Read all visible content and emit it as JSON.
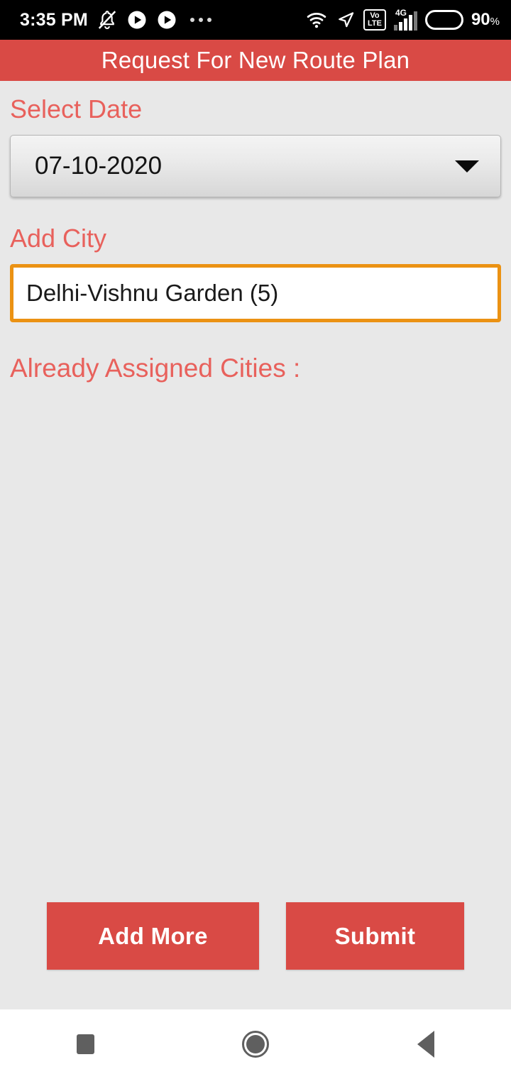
{
  "status_bar": {
    "time": "3:35 PM",
    "icons": [
      "bell-muted-icon",
      "play-circle-icon",
      "play-circle-icon",
      "overflow-dots-icon"
    ],
    "wifi": "wifi-icon",
    "location": "location-arrow-icon",
    "volte_top": "Vo",
    "volte_bottom": "LTE",
    "network_type": "4G",
    "battery_percent": "90",
    "battery_percent_symbol": "%"
  },
  "title_bar": {
    "title": "Request For New Route Plan"
  },
  "form": {
    "date_label": "Select Date",
    "date_value": "07-10-2020",
    "city_label": "Add City",
    "city_value": "Delhi-Vishnu Garden (5)",
    "city_placeholder": "Delhi-Vishnu Garden (5)",
    "assigned_label": "Already Assigned Cities :",
    "assigned_items": []
  },
  "actions": {
    "add_more_label": "Add More",
    "submit_label": "Submit"
  },
  "nav_bar": {
    "recents": "square-recents-icon",
    "home": "circle-home-icon",
    "back": "triangle-back-icon"
  },
  "colors": {
    "accent_red": "#d94a45",
    "label_coral": "#e8615c",
    "input_border_orange": "#eb9213",
    "page_background": "#e8e8e8"
  }
}
